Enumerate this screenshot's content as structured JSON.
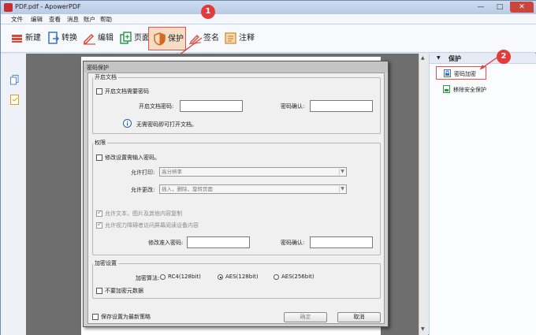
{
  "window": {
    "title": "PDF.pdf - ApowerPDF",
    "minimize": "—",
    "maximize": "□",
    "close": "✕"
  },
  "menu": [
    "文件",
    "编辑",
    "查看",
    "消息",
    "账户",
    "帮助"
  ],
  "toolbar": {
    "new": "新建",
    "convert": "转换",
    "edit": "编辑",
    "page": "页面",
    "protect": "保护",
    "sign": "签名",
    "annotate": "注释"
  },
  "callouts": {
    "one": "1",
    "two": "2"
  },
  "right_panel": {
    "header": "保护",
    "password_encrypt": "密码加密",
    "remove_security": "移除安全保护"
  },
  "dialog": {
    "title": "密码保护",
    "open_doc": {
      "legend": "开启文档",
      "require_password": "开启文档需要密码",
      "open_password_label": "开启文档密码:",
      "confirm_label": "密码确认:",
      "info": "无需密码即可打开文档。"
    },
    "permissions": {
      "legend": "权限",
      "require_password": "修改设置需输入密码。",
      "allow_print_label": "允许打印:",
      "allow_print_value": "高分辨率",
      "allow_change_label": "允许更改:",
      "allow_change_value": "插入，删除，旋转页面",
      "allow_copy": "允许文本，图片及其他内容复制",
      "allow_screen_reader": "允许视力障碍者访问屏幕阅读设备内容",
      "change_password_label": "修改准入密码:",
      "confirm_label": "密码确认:"
    },
    "encryption": {
      "legend": "加密设置",
      "algorithm_label": "加密算法:",
      "options": [
        "RC4(128bit)",
        "AES(128bit)",
        "AES(256bit)"
      ],
      "selected": "AES(128bit)",
      "no_metadata": "不要加密元数据"
    },
    "save_as_default": "保存设置为最新策略",
    "ok": "确定",
    "cancel": "取消"
  },
  "colors": {
    "callout": "#e43a3a",
    "highlight_border": "#e25050",
    "protect_bg": "#f5dcc4"
  }
}
